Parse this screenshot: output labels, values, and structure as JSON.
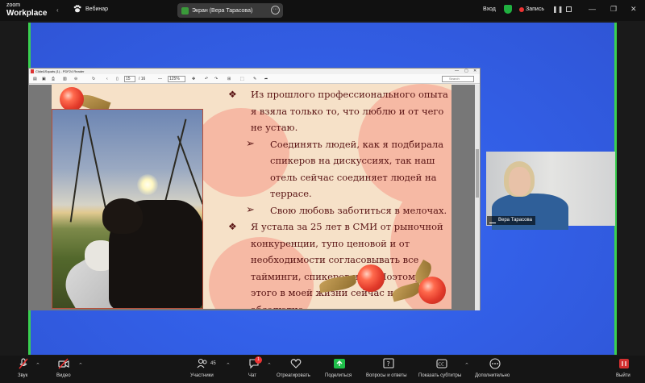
{
  "app": {
    "brand_line1": "zoom",
    "brand_line2": "Workplace",
    "meeting_name": "Вебинар",
    "screen_share_label": "Экран (Вера Тарасова)",
    "login_label": "Вход",
    "recording_label": "Запись",
    "colors": {
      "stage": "#3360e8",
      "active_speaker_border": "#3ad050",
      "record_dot": "#e33333",
      "security_green": "#20b040"
    }
  },
  "pdf": {
    "window_title": "Сlide&Squats (1) - PDF24 Reader",
    "current_page": "15",
    "total_pages": "/ 16",
    "zoom": "125%",
    "search_placeholder": "Search"
  },
  "slide": {
    "bullets": [
      {
        "type": "main",
        "marker": "❖",
        "text": "Из прошлого профессионального опыта я взяла только то, что люблю и от чего не устаю."
      },
      {
        "type": "sub",
        "marker": "➢",
        "text": "Соединять людей, как я подбирала спикеров на дискуссиях, так наш отель сейчас соединяет людей на террасе."
      },
      {
        "type": "sub",
        "marker": "➢",
        "text": "Свою любовь заботиться в мелочах."
      },
      {
        "type": "main",
        "marker": "❖",
        "text": "Я устала за 25 лет в СМИ от рыночной конкуренции, тупо ценовой и от необходимости согласовывать все тайминги, спикеров и тд. Поэтому этого в моей жизни сейчас нет абсолютно."
      }
    ]
  },
  "participant": {
    "name": "Вера Тарасова"
  },
  "toolbar": {
    "audio": "Звук",
    "video": "Видео",
    "participants": "Участники",
    "participants_count": "45",
    "chat": "Чат",
    "chat_badge": "1",
    "react": "Отреагировать",
    "share": "Поделиться",
    "qa": "Вопросы и ответы",
    "captions": "Показать субтитры",
    "more": "Дополнительно",
    "leave_label": "Выйти"
  }
}
